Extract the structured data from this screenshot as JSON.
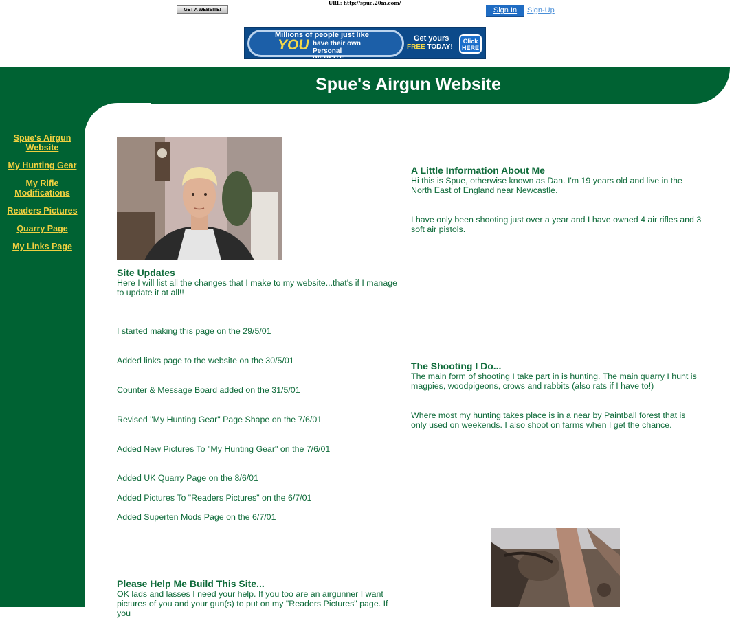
{
  "topbar": {
    "get_website_label": "GET A WEBSITE!",
    "url_text": "URL: http://spue.20m.com/",
    "signin_label": "Sign In",
    "signup_label": "Sign-Up"
  },
  "banner": {
    "line1": "Millions of people just like",
    "you": "YOU",
    "line2": "have their own Personal WEBSITE",
    "get_yours": "Get yours",
    "free": "FREE",
    "today": "TODAY!",
    "click_here": "Click HERE"
  },
  "header": {
    "title": "Spue's Airgun Website"
  },
  "nav": {
    "items": [
      {
        "label": "Spue's Airgun Website"
      },
      {
        "label": "My Hunting Gear"
      },
      {
        "label": "My Rifle Modifications"
      },
      {
        "label": "Readers Pictures"
      },
      {
        "label": "Quarry Page"
      },
      {
        "label": "My Links Page"
      }
    ]
  },
  "updates": {
    "heading": "Site Updates",
    "intro": "Here I will list all the changes that I make to my website...that's if I manage to update it at all!!",
    "items": [
      "I started making this page on the 29/5/01",
      "Added links page to the website on the 30/5/01",
      "Counter & Message Board added on the 31/5/01",
      "Revised \"My Hunting Gear\" Page Shape on the 7/6/01",
      "Added New Pictures To \"My Hunting Gear\" on the 7/6/01",
      "Added UK Quarry Page on the 8/6/01",
      "Added Pictures To \"Readers Pictures\" on the 6/7/01",
      "Added Superten Mods Page on the 6/7/01"
    ]
  },
  "help": {
    "heading": "Please Help Me Build This Site...",
    "text": "OK lads and lasses I need your help. If you too are an airgunner I want pictures of you and your gun(s) to put on my \"Readers Pictures\" page. If you"
  },
  "about": {
    "heading": "A Little Information About Me",
    "p1": "Hi this is Spue, otherwise known as Dan. I'm 19 years old and live in the North East of England near Newcastle.",
    "p2": "I have only been shooting just over a year and I have owned 4 air rifles and 3 soft air pistols."
  },
  "shooting": {
    "heading": "The Shooting I Do...",
    "p1": "The main form of shooting I take part in is hunting. The main quarry I hunt is magpies, woodpigeons, crows and rabbits (also rats if I have to!)",
    "p2": "Where most my hunting takes place is in a near by Paintball forest that is only used on weekends. I also shoot on farms when I get the chance."
  },
  "colors": {
    "green": "#006233",
    "nav_link": "#f0d040",
    "text": "#0f6b3a"
  }
}
